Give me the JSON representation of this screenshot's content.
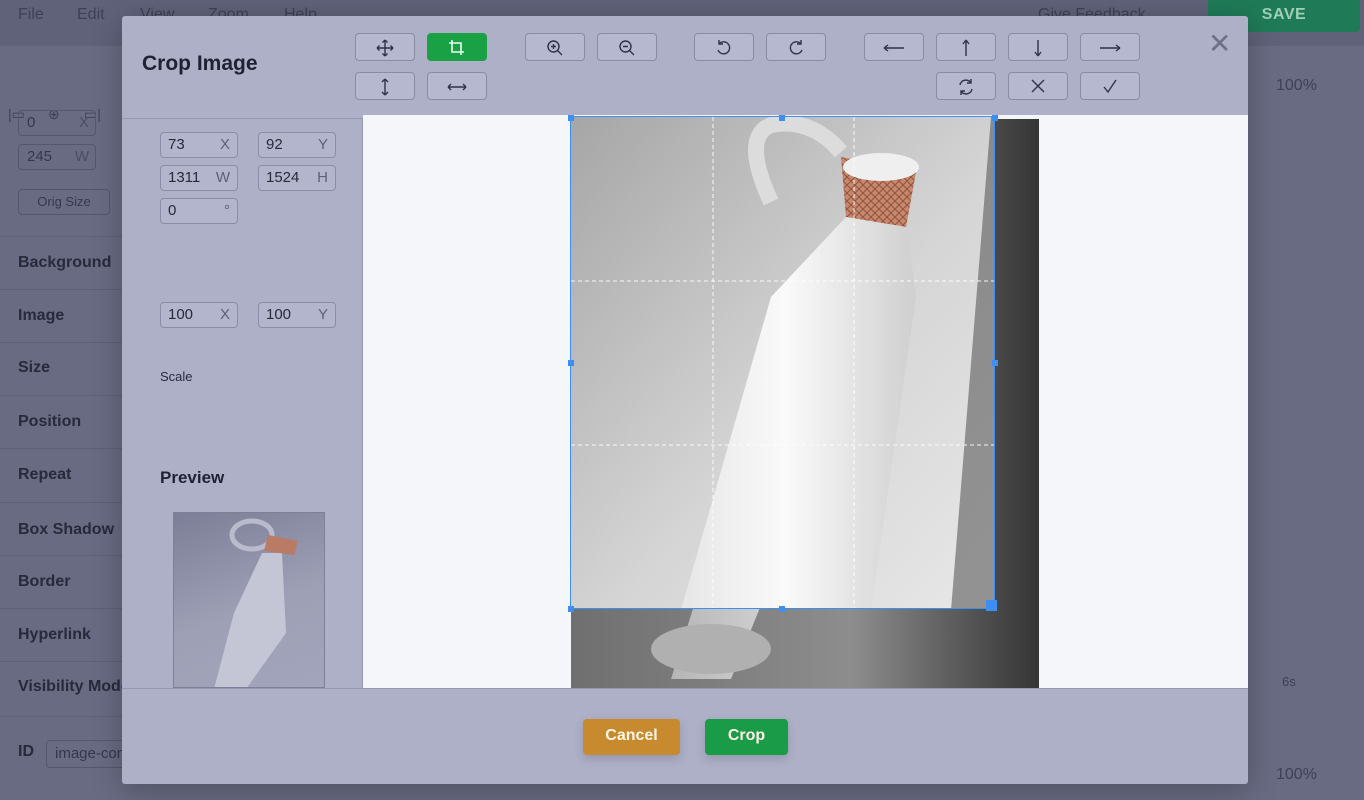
{
  "menubar": {
    "items": [
      "File",
      "Edit",
      "View",
      "Zoom",
      "Help"
    ],
    "feedback": "Give Feedback",
    "save": "SAVE"
  },
  "sidebar": {
    "x_value": "0",
    "x_suffix": "X",
    "w_value": "245",
    "w_suffix": "W",
    "orig_size": "Orig Size",
    "sections": [
      "Background",
      "Image",
      "Size",
      "Position",
      "Repeat",
      "Box Shadow",
      "Border",
      "Hyperlink",
      "Visibility Mode"
    ],
    "id_label": "ID",
    "id_value": "image-container"
  },
  "right_bg": {
    "zoom_top": "100%",
    "zoom_bottom": "100%",
    "timeline_label": "6s"
  },
  "modal": {
    "title": "Crop Image",
    "toolbar_icons": [
      "move-icon",
      "crop-icon",
      "zoom-in-icon",
      "zoom-out-icon",
      "rotate-left-icon",
      "rotate-right-icon",
      "arrow-left-icon",
      "arrow-up-icon",
      "arrow-down-icon",
      "arrow-right-icon",
      "flip-vertical-icon",
      "flip-horizontal-icon",
      "reset-icon",
      "clear-icon",
      "check-icon"
    ],
    "fields": {
      "x": "73",
      "x_suffix": "X",
      "y": "92",
      "y_suffix": "Y",
      "w": "1311",
      "w_suffix": "W",
      "h": "1524",
      "h_suffix": "H",
      "rotate": "0",
      "rotate_suffix": "°"
    },
    "scale_label": "Scale",
    "scale_x": "100",
    "scale_x_suffix": "X",
    "scale_y": "100",
    "scale_y_suffix": "Y",
    "preview_label": "Preview",
    "cancel": "Cancel",
    "crop": "Crop",
    "accent_color": "#1aa146",
    "cancel_color": "#c88a2e",
    "crop_outline_color": "#3d8ef5"
  }
}
